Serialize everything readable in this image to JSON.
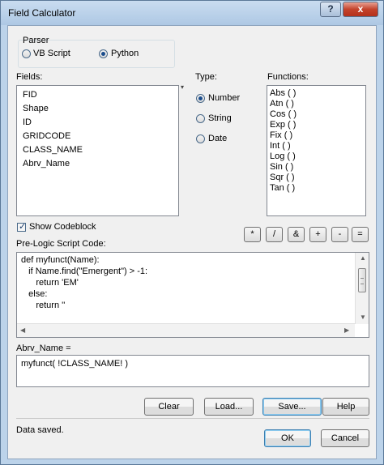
{
  "window": {
    "title": "Field Calculator",
    "help_button": "?",
    "close_button": "x"
  },
  "parser": {
    "label": "Parser",
    "options": [
      "VB Script",
      "Python"
    ],
    "selected": "Python"
  },
  "fields": {
    "label": "Fields:",
    "items": [
      "FID",
      "Shape",
      "ID",
      "GRIDCODE",
      "CLASS_NAME",
      "Abrv_Name"
    ]
  },
  "type": {
    "label": "Type:",
    "options": [
      "Number",
      "String",
      "Date"
    ],
    "selected": "Number"
  },
  "functions": {
    "label": "Functions:",
    "items": [
      "Abs ( )",
      "Atn ( )",
      "Cos ( )",
      "Exp ( )",
      "Fix ( )",
      "Int ( )",
      "Log ( )",
      "Sin ( )",
      "Sqr ( )",
      "Tan ( )"
    ]
  },
  "codeblock": {
    "label": "Show Codeblock",
    "checked": true
  },
  "operators": [
    "*",
    "/",
    "&",
    "+",
    "-",
    "="
  ],
  "prelogic": {
    "label": "Pre-Logic Script Code:",
    "lines": [
      "def myfunct(Name):",
      "   if Name.find(\"Emergent\") > -1:",
      "      return 'EM'",
      "   else:",
      "      return ''"
    ]
  },
  "expression": {
    "label": "Abrv_Name =",
    "value": "myfunct( !CLASS_NAME! )"
  },
  "buttons": {
    "clear": "Clear",
    "load": "Load...",
    "save": "Save...",
    "help": "Help",
    "ok": "OK",
    "cancel": "Cancel"
  },
  "status": "Data saved."
}
